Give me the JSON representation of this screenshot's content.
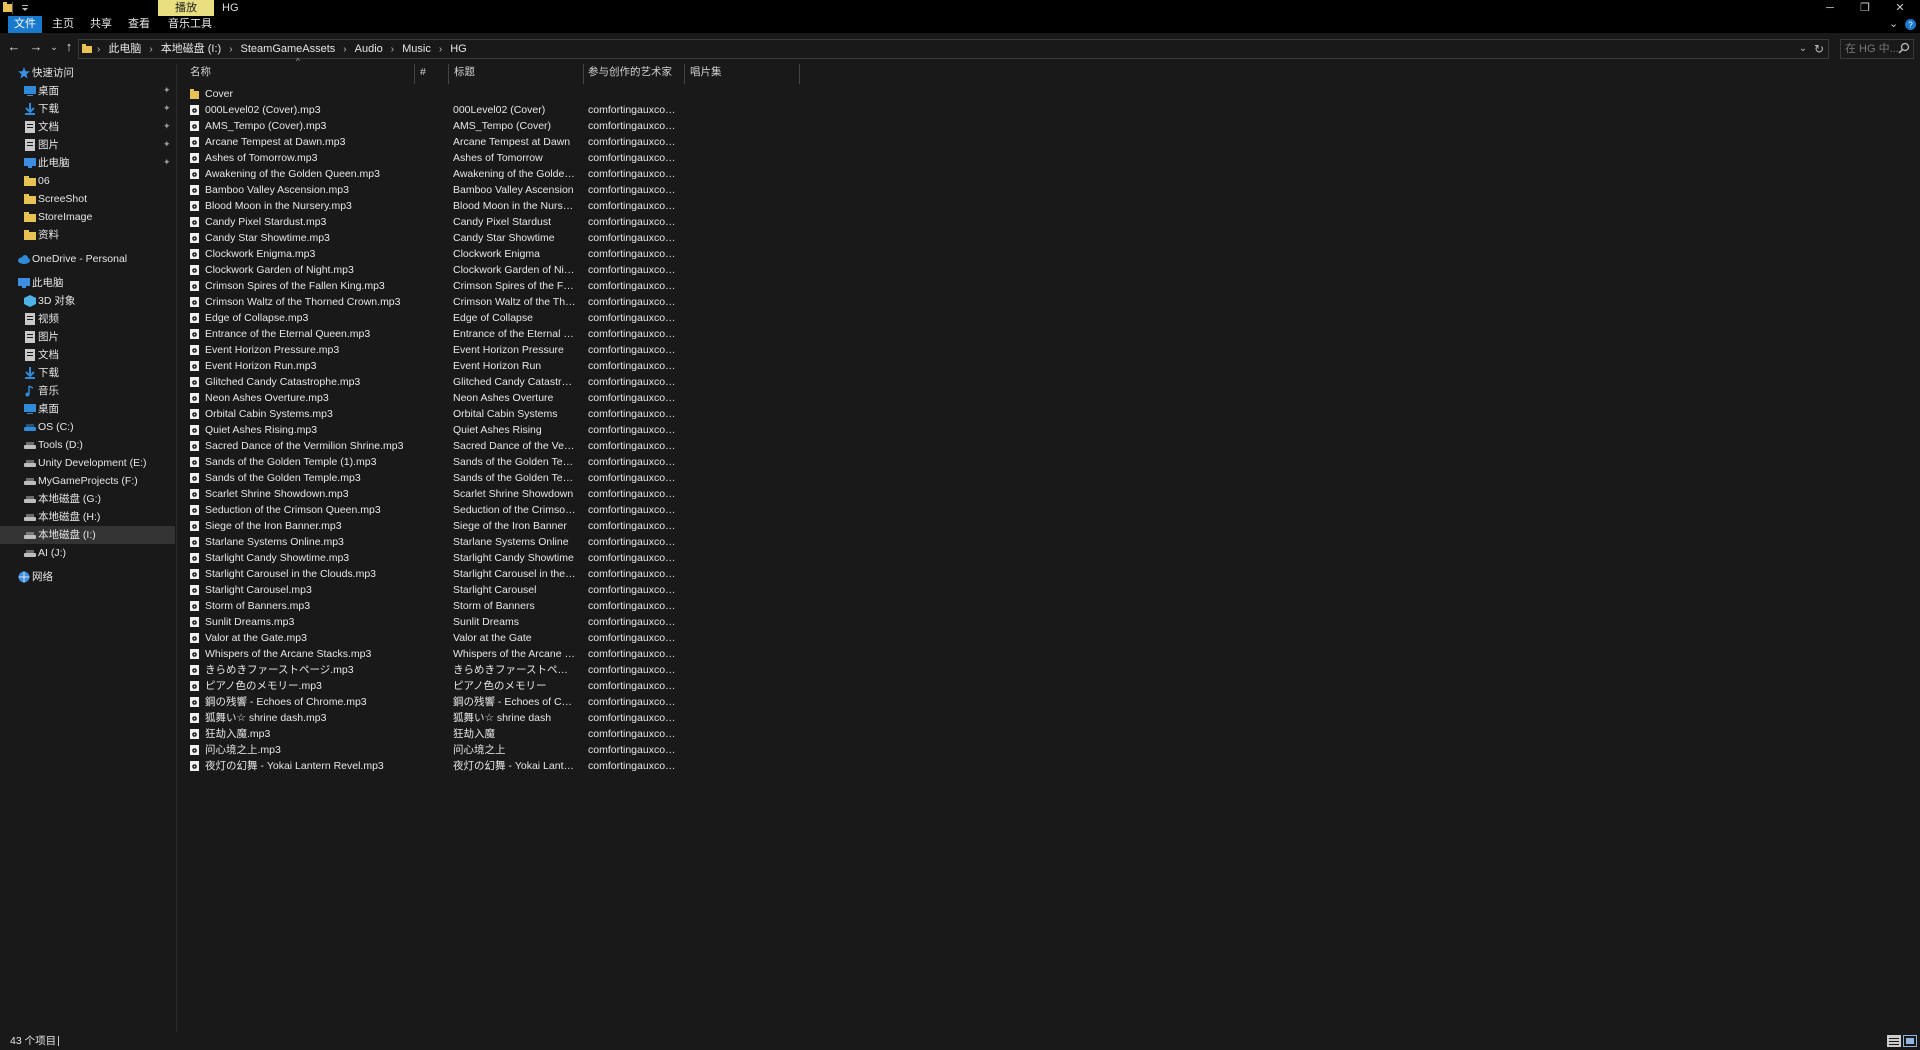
{
  "window": {
    "title": "HG",
    "context_tab": "播放"
  },
  "ribbon": {
    "tabs": [
      "文件",
      "主页",
      "共享",
      "查看",
      "音乐工具"
    ]
  },
  "address": {
    "crumbs": [
      "此电脑",
      "本地磁盘 (I:)",
      "SteamGameAssets",
      "Audio",
      "Music",
      "HG"
    ],
    "search_placeholder": "在 HG 中..."
  },
  "sidebar": {
    "items": [
      {
        "label": "快速访问",
        "icon": "star-icon",
        "color": "#3d8ee0",
        "indent": 0,
        "pinned": false
      },
      {
        "label": "桌面",
        "icon": "desktop-icon",
        "color": "#2f8ad8",
        "indent": 1,
        "pinned": true
      },
      {
        "label": "下载",
        "icon": "download-icon",
        "color": "#2f8ad8",
        "indent": 1,
        "pinned": true
      },
      {
        "label": "文档",
        "icon": "document-icon",
        "color": "#c9c9c9",
        "indent": 1,
        "pinned": true
      },
      {
        "label": "图片",
        "icon": "pictures-icon",
        "color": "#c9c9c9",
        "indent": 1,
        "pinned": true
      },
      {
        "label": "此电脑",
        "icon": "computer-icon",
        "color": "#3d8ee0",
        "indent": 1,
        "pinned": true
      },
      {
        "label": "06",
        "icon": "folder-icon",
        "color": "#e8c252",
        "indent": 1,
        "pinned": false
      },
      {
        "label": "ScreeShot",
        "icon": "folder-icon",
        "color": "#e8c252",
        "indent": 1,
        "pinned": false
      },
      {
        "label": "StoreImage",
        "icon": "folder-icon",
        "color": "#e8c252",
        "indent": 1,
        "pinned": false
      },
      {
        "label": "资料",
        "icon": "folder-icon",
        "color": "#e8c252",
        "indent": 1,
        "pinned": false
      },
      {
        "label": "OneDrive - Personal",
        "icon": "cloud-icon",
        "color": "#2f8ad8",
        "indent": 0,
        "pinned": false
      },
      {
        "label": "此电脑",
        "icon": "computer-icon",
        "color": "#3d8ee0",
        "indent": 0,
        "pinned": false
      },
      {
        "label": "3D 对象",
        "icon": "3d-objects-icon",
        "color": "#4fb3e8",
        "indent": 1,
        "pinned": false
      },
      {
        "label": "视频",
        "icon": "video-icon",
        "color": "#c9c9c9",
        "indent": 1,
        "pinned": false
      },
      {
        "label": "图片",
        "icon": "pictures-icon",
        "color": "#c9c9c9",
        "indent": 1,
        "pinned": false
      },
      {
        "label": "文档",
        "icon": "document-icon",
        "color": "#c9c9c9",
        "indent": 1,
        "pinned": false
      },
      {
        "label": "下载",
        "icon": "download-icon",
        "color": "#2f8ad8",
        "indent": 1,
        "pinned": false
      },
      {
        "label": "音乐",
        "icon": "music-icon",
        "color": "#2f8ad8",
        "indent": 1,
        "pinned": false
      },
      {
        "label": "桌面",
        "icon": "desktop-icon",
        "color": "#2f8ad8",
        "indent": 1,
        "pinned": false
      },
      {
        "label": "OS (C:)",
        "icon": "drive-icon",
        "color": "#2f8ad8",
        "indent": 1,
        "pinned": false
      },
      {
        "label": "Tools (D:)",
        "icon": "drive-icon",
        "color": "#bdbdbd",
        "indent": 1,
        "pinned": false
      },
      {
        "label": "Unity Development (E:)",
        "icon": "drive-icon",
        "color": "#bdbdbd",
        "indent": 1,
        "pinned": false
      },
      {
        "label": "MyGameProjects (F:)",
        "icon": "drive-icon",
        "color": "#bdbdbd",
        "indent": 1,
        "pinned": false
      },
      {
        "label": "本地磁盘 (G:)",
        "icon": "drive-icon",
        "color": "#bdbdbd",
        "indent": 1,
        "pinned": false
      },
      {
        "label": "本地磁盘 (H:)",
        "icon": "drive-icon",
        "color": "#bdbdbd",
        "indent": 1,
        "pinned": false
      },
      {
        "label": "本地磁盘 (I:)",
        "icon": "drive-icon",
        "color": "#bdbdbd",
        "indent": 1,
        "pinned": false,
        "selected": true
      },
      {
        "label": "AI (J:)",
        "icon": "drive-icon",
        "color": "#bdbdbd",
        "indent": 1,
        "pinned": false
      },
      {
        "label": "网络",
        "icon": "network-icon",
        "color": "#3d8ee0",
        "indent": 0,
        "pinned": false
      }
    ]
  },
  "list": {
    "headers": {
      "name": "名称",
      "number": "#",
      "title": "标题",
      "artist": "参与创作的艺术家",
      "album": "唱片集"
    },
    "rows": [
      {
        "name": "Cover",
        "title": "",
        "artist": "",
        "type": "folder"
      },
      {
        "name": "000Level02 (Cover).mp3",
        "title": "000Level02 (Cover)",
        "artist": "comfortingauxcord...",
        "type": "mp3"
      },
      {
        "name": "AMS_Tempo (Cover).mp3",
        "title": "AMS_Tempo (Cover)",
        "artist": "comfortingauxcord...",
        "type": "mp3"
      },
      {
        "name": "Arcane Tempest at Dawn.mp3",
        "title": "Arcane Tempest at Dawn",
        "artist": "comfortingauxcord...",
        "type": "mp3"
      },
      {
        "name": "Ashes of Tomorrow.mp3",
        "title": "Ashes of Tomorrow",
        "artist": "comfortingauxcord...",
        "type": "mp3"
      },
      {
        "name": "Awakening of the Golden Queen.mp3",
        "title": "Awakening of the Golden ...",
        "artist": "comfortingauxcord...",
        "type": "mp3"
      },
      {
        "name": "Bamboo Valley Ascension.mp3",
        "title": "Bamboo Valley Ascension",
        "artist": "comfortingauxcord...",
        "type": "mp3"
      },
      {
        "name": "Blood Moon in the Nursery.mp3",
        "title": "Blood Moon in the Nursery",
        "artist": "comfortingauxcord...",
        "type": "mp3"
      },
      {
        "name": "Candy Pixel Stardust.mp3",
        "title": "Candy Pixel Stardust",
        "artist": "comfortingauxcord...",
        "type": "mp3"
      },
      {
        "name": "Candy Star Showtime.mp3",
        "title": "Candy Star Showtime",
        "artist": "comfortingauxcord...",
        "type": "mp3"
      },
      {
        "name": "Clockwork Enigma.mp3",
        "title": "Clockwork Enigma",
        "artist": "comfortingauxcord...",
        "type": "mp3"
      },
      {
        "name": "Clockwork Garden of Night.mp3",
        "title": "Clockwork Garden of Night",
        "artist": "comfortingauxcord...",
        "type": "mp3"
      },
      {
        "name": "Crimson Spires of the Fallen King.mp3",
        "title": "Crimson Spires of the Falle...",
        "artist": "comfortingauxcord...",
        "type": "mp3"
      },
      {
        "name": "Crimson Waltz of the Thorned Crown.mp3",
        "title": "Crimson Waltz of the Thorn...",
        "artist": "comfortingauxcord...",
        "type": "mp3"
      },
      {
        "name": "Edge of Collapse.mp3",
        "title": "Edge of Collapse",
        "artist": "comfortingauxcord...",
        "type": "mp3"
      },
      {
        "name": "Entrance of the Eternal Queen.mp3",
        "title": "Entrance of the Eternal Que...",
        "artist": "comfortingauxcord...",
        "type": "mp3"
      },
      {
        "name": "Event Horizon Pressure.mp3",
        "title": "Event Horizon Pressure",
        "artist": "comfortingauxcord...",
        "type": "mp3"
      },
      {
        "name": "Event Horizon Run.mp3",
        "title": "Event Horizon Run",
        "artist": "comfortingauxcord...",
        "type": "mp3"
      },
      {
        "name": "Glitched Candy Catastrophe.mp3",
        "title": "Glitched Candy Catastrophe",
        "artist": "comfortingauxcord...",
        "type": "mp3"
      },
      {
        "name": "Neon Ashes Overture.mp3",
        "title": "Neon Ashes Overture",
        "artist": "comfortingauxcord...",
        "type": "mp3"
      },
      {
        "name": "Orbital Cabin Systems.mp3",
        "title": "Orbital Cabin Systems",
        "artist": "comfortingauxcord...",
        "type": "mp3"
      },
      {
        "name": "Quiet Ashes Rising.mp3",
        "title": "Quiet Ashes Rising",
        "artist": "comfortingauxcord...",
        "type": "mp3"
      },
      {
        "name": "Sacred Dance of the Vermilion Shrine.mp3",
        "title": "Sacred Dance of the Vermil...",
        "artist": "comfortingauxcord...",
        "type": "mp3"
      },
      {
        "name": "Sands of the Golden Temple (1).mp3",
        "title": "Sands of the Golden Temple",
        "artist": "comfortingauxcord...",
        "type": "mp3"
      },
      {
        "name": "Sands of the Golden Temple.mp3",
        "title": "Sands of the Golden Temple",
        "artist": "comfortingauxcord...",
        "type": "mp3"
      },
      {
        "name": "Scarlet Shrine Showdown.mp3",
        "title": "Scarlet Shrine Showdown",
        "artist": "comfortingauxcord...",
        "type": "mp3"
      },
      {
        "name": "Seduction of the Crimson Queen.mp3",
        "title": "Seduction of the Crimson Q...",
        "artist": "comfortingauxcord...",
        "type": "mp3"
      },
      {
        "name": "Siege of the Iron Banner.mp3",
        "title": "Siege of the Iron Banner",
        "artist": "comfortingauxcord...",
        "type": "mp3"
      },
      {
        "name": "Starlane Systems Online.mp3",
        "title": "Starlane Systems Online",
        "artist": "comfortingauxcord...",
        "type": "mp3"
      },
      {
        "name": "Starlight Candy Showtime.mp3",
        "title": "Starlight Candy Showtime",
        "artist": "comfortingauxcord...",
        "type": "mp3"
      },
      {
        "name": "Starlight Carousel in the Clouds.mp3",
        "title": "Starlight Carousel in the Cl...",
        "artist": "comfortingauxcord...",
        "type": "mp3"
      },
      {
        "name": "Starlight Carousel.mp3",
        "title": "Starlight Carousel",
        "artist": "comfortingauxcord...",
        "type": "mp3"
      },
      {
        "name": "Storm of Banners.mp3",
        "title": "Storm of Banners",
        "artist": "comfortingauxcord...",
        "type": "mp3"
      },
      {
        "name": "Sunlit Dreams.mp3",
        "title": "Sunlit Dreams",
        "artist": "comfortingauxcord...",
        "type": "mp3"
      },
      {
        "name": "Valor at the Gate.mp3",
        "title": "Valor at the Gate",
        "artist": "comfortingauxcord...",
        "type": "mp3"
      },
      {
        "name": "Whispers of the Arcane Stacks.mp3",
        "title": "Whispers of the Arcane Sta...",
        "artist": "comfortingauxcord...",
        "type": "mp3"
      },
      {
        "name": "きらめきファーストページ.mp3",
        "title": "きらめきファーストページ",
        "artist": "comfortingauxcord...",
        "type": "mp3"
      },
      {
        "name": "ピアノ色のメモリー.mp3",
        "title": "ピアノ色のメモリー",
        "artist": "comfortingauxcord...",
        "type": "mp3"
      },
      {
        "name": "鋼の残響 - Echoes of Chrome.mp3",
        "title": "鋼の残響 - Echoes of Chrome",
        "artist": "comfortingauxcord...",
        "type": "mp3"
      },
      {
        "name": "狐舞い☆ shrine dash.mp3",
        "title": "狐舞い☆ shrine dash",
        "artist": "comfortingauxcord...",
        "type": "mp3"
      },
      {
        "name": "狂劫入魔.mp3",
        "title": "狂劫入魔",
        "artist": "comfortingauxcord...",
        "type": "mp3"
      },
      {
        "name": "问心境之上.mp3",
        "title": "问心境之上",
        "artist": "comfortingauxcord...",
        "type": "mp3"
      },
      {
        "name": "夜灯の幻舞 - Yokai Lantern Revel.mp3",
        "title": "夜灯の幻舞 - Yokai Lantern ...",
        "artist": "comfortingauxcord...",
        "type": "mp3"
      }
    ]
  },
  "status": {
    "item_count": "43 个项目"
  },
  "colors": {
    "accent": "#1979ca",
    "context_tab": "#e8e080",
    "folder": "#e8c252",
    "background": "#191919"
  }
}
